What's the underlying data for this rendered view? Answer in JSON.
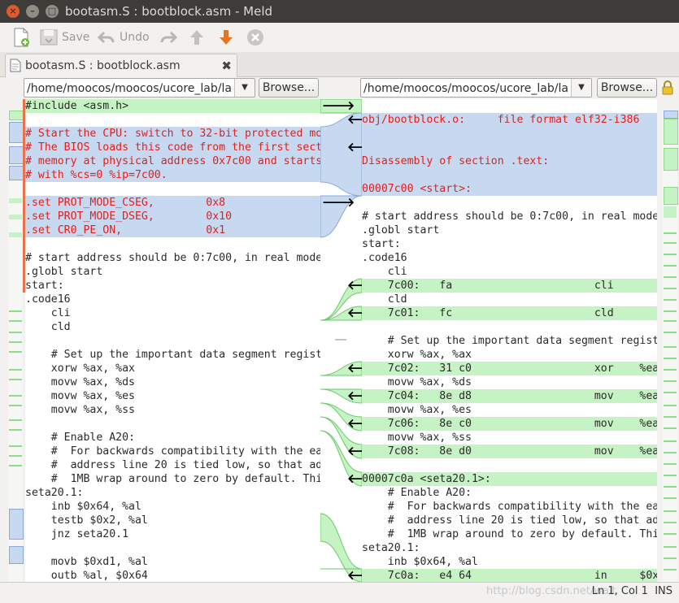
{
  "window": {
    "title": "bootasm.S : bootblock.asm - Meld"
  },
  "toolbar": {
    "save_label": "Save",
    "undo_label": "Undo"
  },
  "tab": {
    "label": "bootasm.S : bootblock.asm",
    "close": "✖"
  },
  "left_pane": {
    "path": "/home/moocos/moocos/ucore_lab/la",
    "browse_label": "Browse...",
    "lines": [
      {
        "t": "#include <asm.h>",
        "c": "ins"
      },
      {
        "t": "",
        "c": ""
      },
      {
        "t": "# Start the CPU: switch to 32-bit protected mo",
        "c": "chg red"
      },
      {
        "t": "# The BIOS loads this code from the first sect",
        "c": "chg red"
      },
      {
        "t": "# memory at physical address 0x7c00 and starts",
        "c": "chg red"
      },
      {
        "t": "# with %cs=0 %ip=7c00.",
        "c": "chg red"
      },
      {
        "t": "",
        "c": ""
      },
      {
        "t": ".set PROT_MODE_CSEG,        0x8",
        "c": "chg red"
      },
      {
        "t": ".set PROT_MODE_DSEG,        0x10",
        "c": "chg red"
      },
      {
        "t": ".set CR0_PE_ON,             0x1",
        "c": "chg red"
      },
      {
        "t": "",
        "c": ""
      },
      {
        "t": "# start address should be 0:7c00, in real mode",
        "c": ""
      },
      {
        "t": ".globl start",
        "c": ""
      },
      {
        "t": "start:",
        "c": ""
      },
      {
        "t": ".code16",
        "c": ""
      },
      {
        "t": "    cli",
        "c": ""
      },
      {
        "t": "    cld",
        "c": ""
      },
      {
        "t": "",
        "c": ""
      },
      {
        "t": "    # Set up the important data segment regist",
        "c": ""
      },
      {
        "t": "    xorw %ax, %ax",
        "c": ""
      },
      {
        "t": "    movw %ax, %ds",
        "c": ""
      },
      {
        "t": "    movw %ax, %es",
        "c": ""
      },
      {
        "t": "    movw %ax, %ss",
        "c": ""
      },
      {
        "t": "",
        "c": ""
      },
      {
        "t": "    # Enable A20:",
        "c": ""
      },
      {
        "t": "    #  For backwards compatibility with the ea",
        "c": ""
      },
      {
        "t": "    #  address line 20 is tied low, so that ad",
        "c": ""
      },
      {
        "t": "    #  1MB wrap around to zero by default. Thi",
        "c": ""
      },
      {
        "t": "seta20.1:",
        "c": ""
      },
      {
        "t": "    inb $0x64, %al",
        "c": ""
      },
      {
        "t": "    testb $0x2, %al",
        "c": ""
      },
      {
        "t": "    jnz seta20.1",
        "c": ""
      },
      {
        "t": "",
        "c": ""
      },
      {
        "t": "    movb $0xd1, %al",
        "c": ""
      },
      {
        "t": "    outb %al, $0x64",
        "c": ""
      }
    ]
  },
  "right_pane": {
    "path": "/home/moocos/moocos/ucore_lab/la",
    "browse_label": "Browse...",
    "lines": [
      {
        "t": "",
        "c": ""
      },
      {
        "t": "obj/bootblock.o:     file format elf32-i386",
        "c": "chg red"
      },
      {
        "t": "",
        "c": "chg"
      },
      {
        "t": "",
        "c": "chg"
      },
      {
        "t": "Disassembly of section .text:",
        "c": "chg red"
      },
      {
        "t": "",
        "c": "chg"
      },
      {
        "t": "00007c00 <start>:",
        "c": "chg red"
      },
      {
        "t": "",
        "c": ""
      },
      {
        "t": "# start address should be 0:7c00, in real mode",
        "c": ""
      },
      {
        "t": ".globl start",
        "c": ""
      },
      {
        "t": "start:",
        "c": ""
      },
      {
        "t": ".code16",
        "c": ""
      },
      {
        "t": "    cli",
        "c": ""
      },
      {
        "t": "    7c00:   fa                      cli",
        "c": "ins"
      },
      {
        "t": "    cld",
        "c": ""
      },
      {
        "t": "    7c01:   fc                      cld",
        "c": "ins"
      },
      {
        "t": "",
        "c": ""
      },
      {
        "t": "    # Set up the important data segment regist",
        "c": ""
      },
      {
        "t": "    xorw %ax, %ax",
        "c": ""
      },
      {
        "t": "    7c02:   31 c0                   xor    %ea",
        "c": "ins"
      },
      {
        "t": "    movw %ax, %ds",
        "c": ""
      },
      {
        "t": "    7c04:   8e d8                   mov    %ea",
        "c": "ins"
      },
      {
        "t": "    movw %ax, %es",
        "c": ""
      },
      {
        "t": "    7c06:   8e c0                   mov    %ea",
        "c": "ins"
      },
      {
        "t": "    movw %ax, %ss",
        "c": ""
      },
      {
        "t": "    7c08:   8e d0                   mov    %ea",
        "c": "ins"
      },
      {
        "t": "",
        "c": ""
      },
      {
        "t": "00007c0a <seta20.1>:",
        "c": "ins"
      },
      {
        "t": "    # Enable A20:",
        "c": ""
      },
      {
        "t": "    #  For backwards compatibility with the ea",
        "c": ""
      },
      {
        "t": "    #  address line 20 is tied low, so that ad",
        "c": ""
      },
      {
        "t": "    #  1MB wrap around to zero by default. Thi",
        "c": ""
      },
      {
        "t": "seta20.1:",
        "c": ""
      },
      {
        "t": "    inb $0x64, %al",
        "c": ""
      },
      {
        "t": "    7c0a:   e4 64                   in     $0x",
        "c": "ins"
      }
    ]
  },
  "statusbar": {
    "position": "Ln 1, Col 1",
    "mode": "INS",
    "watermark": "http://blog.csdn.net/wait"
  },
  "colors": {
    "insert": "#c5f3c4",
    "change": "#c6d9f1",
    "changed_text": "#e0211c",
    "accent_orange": "#e8724a"
  }
}
